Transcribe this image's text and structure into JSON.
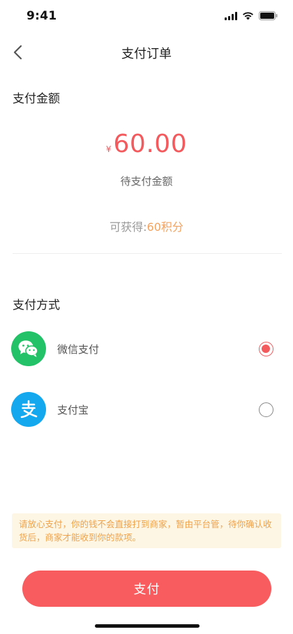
{
  "status_bar": {
    "time": "9:41"
  },
  "nav": {
    "title": "支付订单"
  },
  "amount_section": {
    "title": "支付金额",
    "currency_symbol": "¥",
    "amount": "60.00",
    "amount_label": "待支付金额",
    "points_prefix": "可获得:",
    "points_value": "60积分"
  },
  "payment_section": {
    "title": "支付方式",
    "methods": [
      {
        "label": "微信支付",
        "icon": "wechat-icon",
        "selected": true
      },
      {
        "label": "支付宝",
        "icon": "alipay-icon",
        "selected": false
      }
    ]
  },
  "notice": {
    "text": "请放心支付，你的钱不会直接打到商家，暂由平台管，待你确认收货后，商家才能收到你的款项。"
  },
  "pay_button": {
    "label": "支付"
  },
  "colors": {
    "accent": "#f95c5f",
    "amount": "#f25a5e",
    "points": "#f3a35f",
    "wechat": "#24c268",
    "alipay": "#14a8ef",
    "notice_bg": "#fdf6e5",
    "notice_text": "#efa24a"
  }
}
